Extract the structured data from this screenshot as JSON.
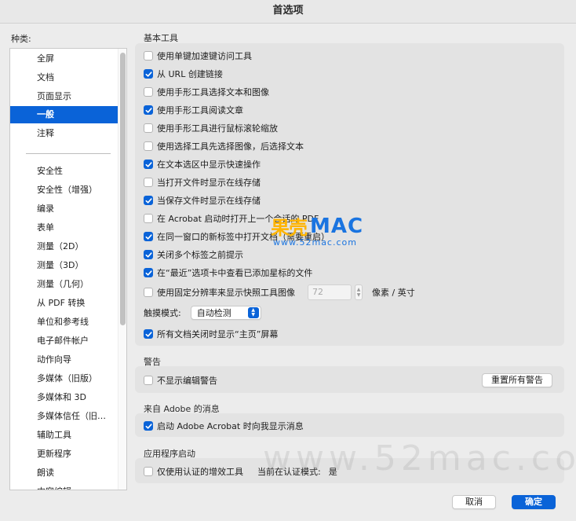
{
  "window": {
    "title": "首选项"
  },
  "sidebar": {
    "label": "种类:",
    "items": [
      {
        "label": "全屏",
        "selected": false
      },
      {
        "label": "文档",
        "selected": false
      },
      {
        "label": "页面显示",
        "selected": false
      },
      {
        "label": "一般",
        "selected": true
      },
      {
        "label": "注释",
        "selected": false
      },
      {
        "label": "安全性",
        "selected": false
      },
      {
        "label": "安全性（增强）",
        "selected": false
      },
      {
        "label": "编录",
        "selected": false
      },
      {
        "label": "表单",
        "selected": false
      },
      {
        "label": "测量（2D）",
        "selected": false
      },
      {
        "label": "测量（3D）",
        "selected": false
      },
      {
        "label": "测量（几何）",
        "selected": false
      },
      {
        "label": "从 PDF 转换",
        "selected": false
      },
      {
        "label": "单位和参考线",
        "selected": false
      },
      {
        "label": "电子邮件帐户",
        "selected": false
      },
      {
        "label": "动作向导",
        "selected": false
      },
      {
        "label": "多媒体（旧版）",
        "selected": false
      },
      {
        "label": "多媒体和 3D",
        "selected": false
      },
      {
        "label": "多媒体信任（旧…",
        "selected": false
      },
      {
        "label": "辅助工具",
        "selected": false
      },
      {
        "label": "更新程序",
        "selected": false
      },
      {
        "label": "朗读",
        "selected": false
      },
      {
        "label": "内容编辑",
        "selected": false
      }
    ]
  },
  "basic_tools": {
    "title": "基本工具",
    "options": [
      {
        "label": "使用单键加速键访问工具",
        "checked": false
      },
      {
        "label": "从 URL 创建链接",
        "checked": true
      },
      {
        "label": "使用手形工具选择文本和图像",
        "checked": false
      },
      {
        "label": "使用手形工具阅读文章",
        "checked": true
      },
      {
        "label": "使用手形工具进行鼠标滚轮缩放",
        "checked": false
      },
      {
        "label": "使用选择工具先选择图像，后选择文本",
        "checked": false
      },
      {
        "label": "在文本选区中显示快速操作",
        "checked": true
      },
      {
        "label": "当打开文件时显示在线存储",
        "checked": false
      },
      {
        "label": "当保存文件时显示在线存储",
        "checked": true
      },
      {
        "label": "在 Acrobat 启动时打开上一个会话的 PDF",
        "checked": false
      },
      {
        "label": "在同一窗口的新标签中打开文档（需要重启）",
        "checked": true
      },
      {
        "label": "关闭多个标签之前提示",
        "checked": true
      },
      {
        "label": "在“最近”选项卡中查看已添加星标的文件",
        "checked": true
      }
    ],
    "fixed_resolution": {
      "label": "使用固定分辨率来显示快照工具图像",
      "checked": false,
      "value": "72",
      "unit": "像素 / 英寸"
    },
    "touch_mode": {
      "label": "触摸模式:",
      "value": "自动检测"
    },
    "show_home": {
      "label": "所有文档关闭时显示“主页”屏幕",
      "checked": true
    }
  },
  "warnings": {
    "title": "警告",
    "no_edit_warning": {
      "label": "不显示编辑警告",
      "checked": false
    },
    "reset_button": "重置所有警告"
  },
  "adobe_messages": {
    "title": "来自 Adobe 的消息",
    "show_messages": {
      "label": "启动 Adobe Acrobat 时向我显示消息",
      "checked": true
    }
  },
  "app_startup": {
    "title": "应用程序启动",
    "certified_plugins": {
      "label": "仅使用认证的增效工具",
      "checked": false
    },
    "certified_mode_label": "当前在认证模式:",
    "certified_mode_value": "是"
  },
  "footer": {
    "cancel": "取消",
    "ok": "确定"
  },
  "watermark": {
    "logo": "果壳",
    "brand": "MAC",
    "url": "www.52mac.com",
    "big": "www.52mac.com"
  },
  "colors": {
    "accent": "#0a63d8",
    "panel": "#e3e3e3",
    "window": "#ececec"
  }
}
